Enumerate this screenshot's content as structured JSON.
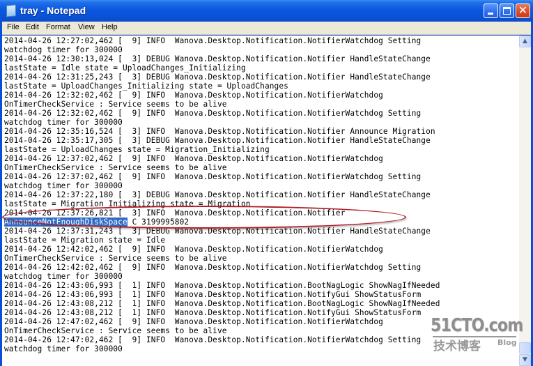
{
  "window": {
    "title": "tray - Notepad",
    "icons": {
      "app": "notepad-icon",
      "minimize": "minimize-icon",
      "maximize": "maximize-icon",
      "close": "close-icon"
    },
    "close_glyph": "✕"
  },
  "menu": {
    "items": [
      {
        "label": "File"
      },
      {
        "label": "Edit"
      },
      {
        "label": "Format"
      },
      {
        "label": "View"
      },
      {
        "label": "Help"
      }
    ]
  },
  "editor": {
    "lines": [
      "2014-04-26 12:27:02,462 [  9] INFO  Wanova.Desktop.Notification.NotifierWatchdog Setting",
      "watchdog timer for 300000",
      "2014-04-26 12:30:13,024 [  3] DEBUG Wanova.Desktop.Notification.Notifier HandleStateChange",
      "lastState = Idle state = UploadChanges_Initializing",
      "2014-04-26 12:31:25,243 [  3] DEBUG Wanova.Desktop.Notification.Notifier HandleStateChange",
      "lastState = UploadChanges_Initializing state = UploadChanges",
      "2014-04-26 12:32:02,462 [  9] INFO  Wanova.Desktop.Notification.NotifierWatchdog",
      "OnTimerCheckService : Service seems to be alive",
      "2014-04-26 12:32:02,462 [  9] INFO  Wanova.Desktop.Notification.NotifierWatchdog Setting",
      "watchdog timer for 300000",
      "2014-04-26 12:35:16,524 [  3] INFO  Wanova.Desktop.Notification.Notifier Announce Migration",
      "2014-04-26 12:35:17,305 [  3] DEBUG Wanova.Desktop.Notification.Notifier HandleStateChange",
      "lastState = UploadChanges state = Migration_Initializing",
      "2014-04-26 12:37:02,462 [  9] INFO  Wanova.Desktop.Notification.NotifierWatchdog",
      "OnTimerCheckService : Service seems to be alive",
      "2014-04-26 12:37:02,462 [  9] INFO  Wanova.Desktop.Notification.NotifierWatchdog Setting",
      "watchdog timer for 300000",
      "2014-04-26 12:37:22,180 [  3] DEBUG Wanova.Desktop.Notification.Notifier HandleStateChange",
      "lastState = Migration_Initializing state = Migration",
      "2014-04-26 12:37:26,821 [  3] INFO  Wanova.Desktop.Notification.Notifier",
      "",
      "2014-04-26 12:37:31,243 [  3] DEBUG Wanova.Desktop.Notification.Notifier HandleStateChange",
      "lastState = Migration state = Idle",
      "2014-04-26 12:42:02,462 [  9] INFO  Wanova.Desktop.Notification.NotifierWatchdog",
      "OnTimerCheckService : Service seems to be alive",
      "2014-04-26 12:42:02,462 [  9] INFO  Wanova.Desktop.Notification.NotifierWatchdog Setting",
      "watchdog timer for 300000",
      "2014-04-26 12:43:06,993 [  1] INFO  Wanova.Desktop.Notification.BootNagLogic ShowNagIfNeeded",
      "2014-04-26 12:43:06,993 [  1] INFO  Wanova.Desktop.Notification.NotifyGui ShowStatusForm",
      "2014-04-26 12:43:08,212 [  1] INFO  Wanova.Desktop.Notification.BootNagLogic ShowNagIfNeeded",
      "2014-04-26 12:43:08,212 [  1] INFO  Wanova.Desktop.Notification.NotifyGui ShowStatusForm",
      "2014-04-26 12:47:02,462 [  9] INFO  Wanova.Desktop.Notification.NotifierWatchdog",
      "OnTimerCheckService : Service seems to be alive",
      "2014-04-26 12:47:02,462 [  9] INFO  Wanova.Desktop.Notification.NotifierWatchdog Setting",
      "watchdog timer for 300000"
    ],
    "selected_text": "AnnounceNotEnoughDiskSpace",
    "after_selection_text": " C 3199995802",
    "highlight_color": "#316ac5",
    "annotation_color": "#b0202a"
  },
  "scrollbar": {
    "up_glyph": "▲",
    "down_glyph": "▼",
    "position_fraction": 1.0
  },
  "watermark": {
    "main": "51CTO.com",
    "sub": "技术博客",
    "blog": "Blog"
  }
}
